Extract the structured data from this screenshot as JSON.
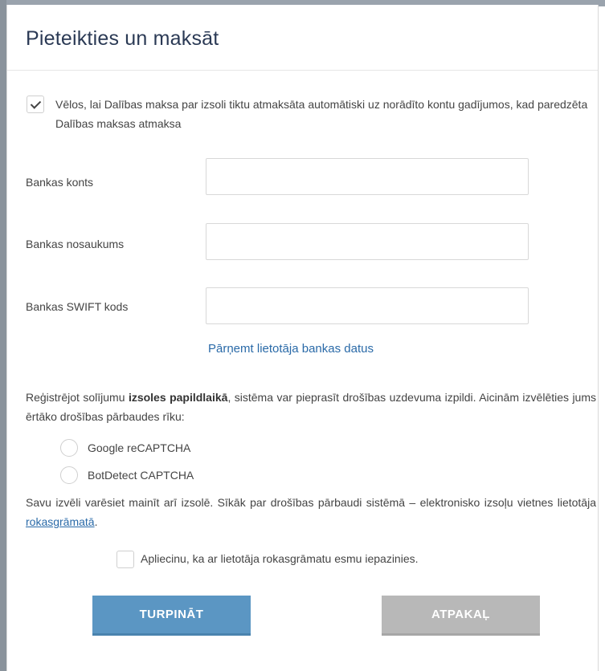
{
  "dialog": {
    "title": "Pieteikties un maksāt"
  },
  "refund": {
    "checked": true,
    "text": "Vēlos, lai Dalības maksa par izsoli tiktu atmaksāta automātiski uz norādīto kontu gadījumos, kad paredzēta Dalības maksas atmaksa"
  },
  "fields": {
    "account_label": "Bankas konts",
    "account_value": "",
    "bank_name_label": "Bankas nosaukums",
    "bank_name_value": "",
    "swift_label": "Bankas SWIFT kods",
    "swift_value": ""
  },
  "copy_link": "Pārņemt lietotāja bankas datus",
  "security": {
    "intro_part1": "Reģistrējot solījumu ",
    "intro_bold": "izsoles papildlaikā",
    "intro_part2": ", sistēma var pieprasīt drošības uzdevuma izpildi. Aicinām izvēlēties jums ērtāko drošības pārbaudes rīku:",
    "options": [
      {
        "label": "Google reCAPTCHA",
        "selected": false
      },
      {
        "label": "BotDetect CAPTCHA",
        "selected": false
      }
    ],
    "note_part1": "Savu izvēli varēsiet mainīt arī izsolē. Sīkāk par drošības pārbaudi sistēmā – elektronisko izsoļu vietnes lietotāja ",
    "note_link": "rokasgrāmatā",
    "note_part2": "."
  },
  "acknowledge": {
    "checked": false,
    "text": "Apliecinu, ka ar lietotāja rokasgrāmatu esmu iepazinies."
  },
  "buttons": {
    "continue": "TURPINĀT",
    "back": "ATPAKAĻ"
  },
  "colors": {
    "title": "#2b3a55",
    "link": "#2a6aa8",
    "continue_button": "#5b96c3",
    "back_button": "#b8b8b8"
  }
}
